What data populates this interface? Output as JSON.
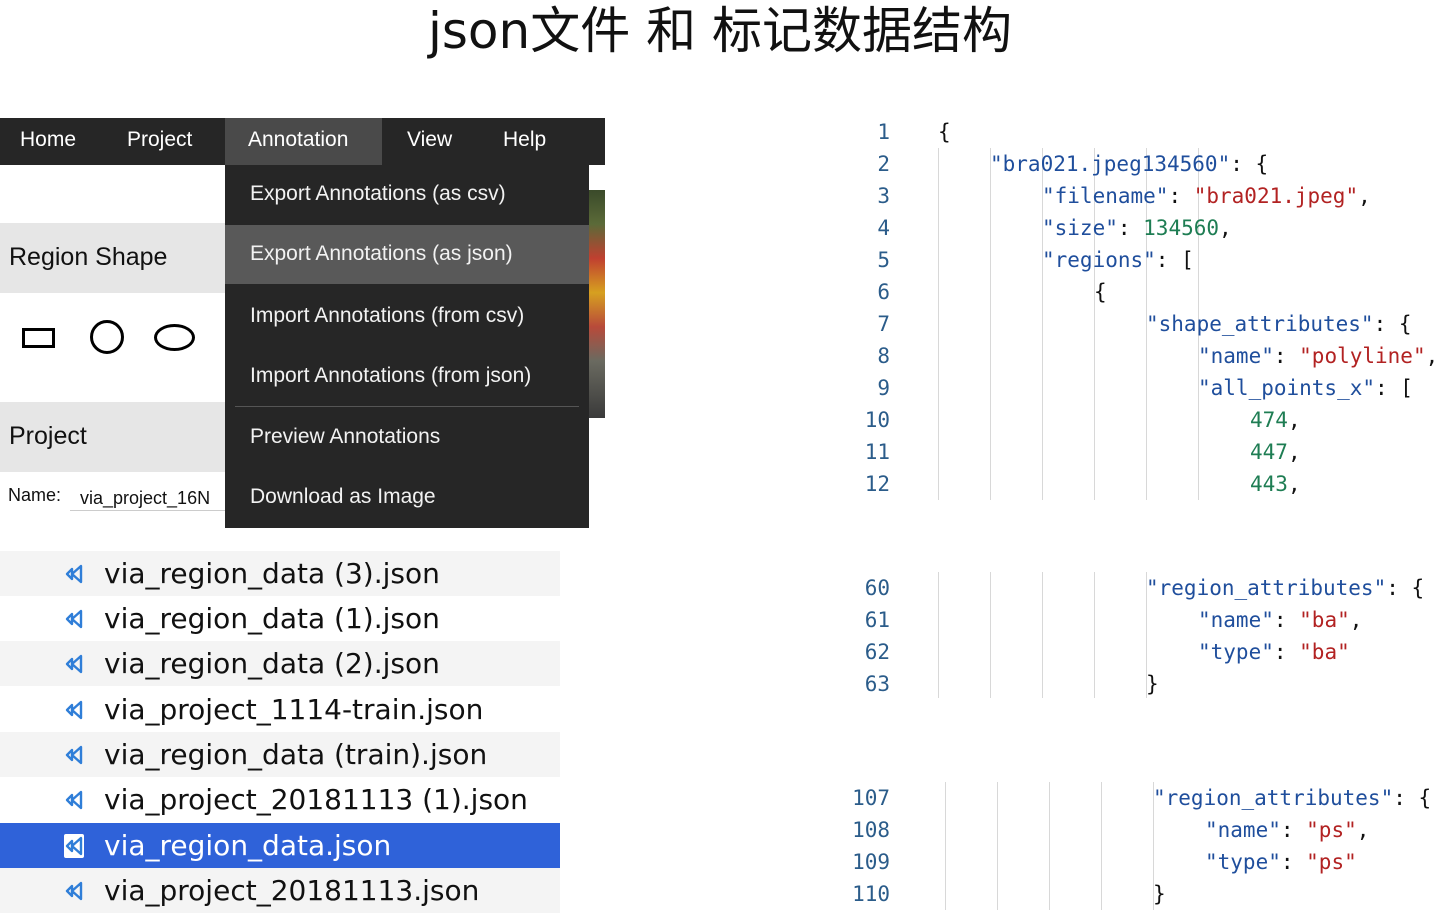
{
  "title": "json文件 和 标记数据结构",
  "via": {
    "menu": [
      "Home",
      "Project",
      "Annotation",
      "View",
      "Help"
    ],
    "active_menu": "Annotation",
    "dropdown": [
      "Export Annotations (as csv)",
      "Export Annotations (as json)",
      "Import Annotations (from csv)",
      "Import Annotations (from json)",
      "Preview Annotations",
      "Download as Image"
    ],
    "highlighted_item": "Export Annotations (as json)",
    "region_shape_label": "Region Shape",
    "project_label": "Project",
    "name_label": "Name:",
    "name_value": "via_project_16N"
  },
  "files": [
    "via_region_data (3).json",
    "via_region_data (1).json",
    "via_region_data (2).json",
    "via_project_1114-train.json",
    "via_region_data (train).json",
    "via_project_20181113 (1).json",
    "via_region_data.json",
    "via_project_20181113.json"
  ],
  "selected_file": "via_region_data.json",
  "code_block_1": [
    {
      "ln": "1",
      "text": "{"
    },
    {
      "ln": "2",
      "key": "\"bra021.jpeg134560\"",
      "rest": ": {"
    },
    {
      "ln": "3",
      "key": "\"filename\"",
      "sep": ": ",
      "str": "\"bra021.jpeg\"",
      "rest": ","
    },
    {
      "ln": "4",
      "key": "\"size\"",
      "sep": ": ",
      "num": "134560",
      "rest": ","
    },
    {
      "ln": "5",
      "key": "\"regions\"",
      "rest": ": ["
    },
    {
      "ln": "6",
      "text": "{"
    },
    {
      "ln": "7",
      "key": "\"shape_attributes\"",
      "rest": ": {"
    },
    {
      "ln": "8",
      "key": "\"name\"",
      "sep": ": ",
      "str": "\"polyline\"",
      "rest": ","
    },
    {
      "ln": "9",
      "key": "\"all_points_x\"",
      "rest": ": ["
    },
    {
      "ln": "10",
      "num": "474",
      "rest": ","
    },
    {
      "ln": "11",
      "num": "447",
      "rest": ","
    },
    {
      "ln": "12",
      "num": "443",
      "rest": ","
    }
  ],
  "code_block_2": [
    {
      "ln": "60",
      "key": "\"region_attributes\"",
      "rest": ": {"
    },
    {
      "ln": "61",
      "key": "\"name\"",
      "sep": ": ",
      "str": "\"ba\"",
      "rest": ","
    },
    {
      "ln": "62",
      "key": "\"type\"",
      "sep": ": ",
      "str": "\"ba\"",
      "rest": ""
    },
    {
      "ln": "63",
      "text": "}"
    }
  ],
  "code_block_3": [
    {
      "ln": "107",
      "key": "\"region_attributes\"",
      "rest": ": {"
    },
    {
      "ln": "108",
      "key": "\"name\"",
      "sep": ": ",
      "str": "\"ps\"",
      "rest": ","
    },
    {
      "ln": "109",
      "key": "\"type\"",
      "sep": ": ",
      "str": "\"ps\"",
      "rest": ""
    },
    {
      "ln": "110",
      "text": "}"
    }
  ],
  "colors": {
    "menubar": "#262626",
    "menu_active": "#4a4a4a",
    "dropdown_hover": "#595959",
    "selection": "#2f62d9",
    "json_key": "#1f4e9c",
    "json_string": "#b22222",
    "json_number": "#1e7d53",
    "line_number": "#2b5c8a"
  },
  "icons": {
    "file": "vscode-json-file-icon",
    "shapes": [
      "rectangle-shape-icon",
      "circle-shape-icon",
      "ellipse-shape-icon"
    ]
  }
}
